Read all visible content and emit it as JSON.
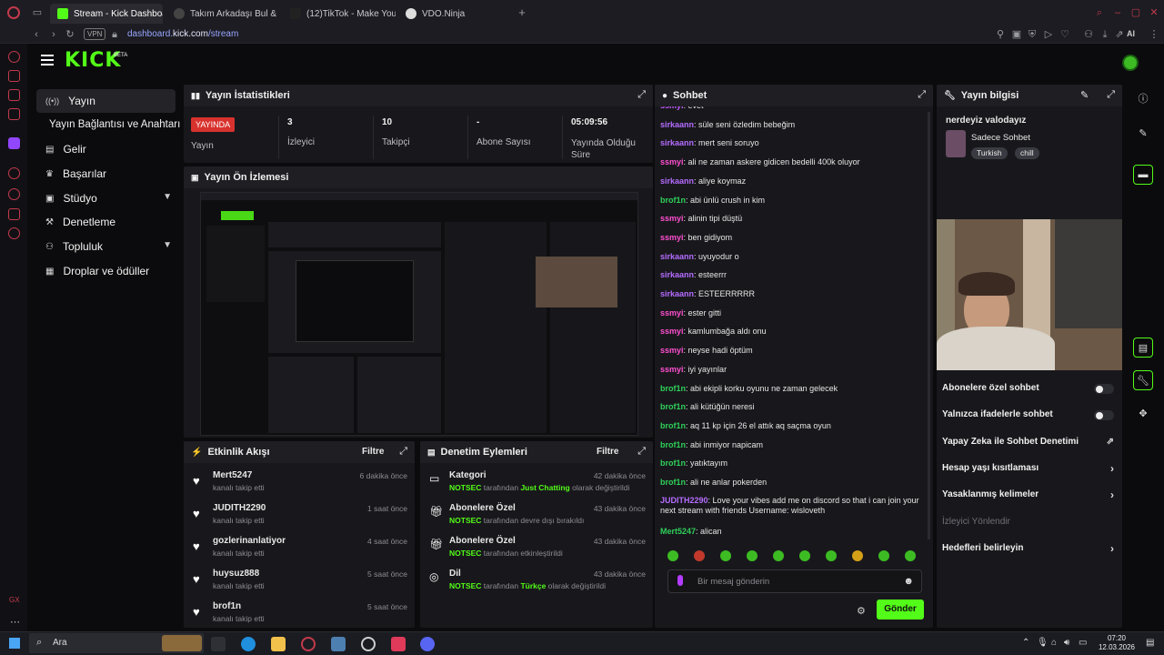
{
  "browser": {
    "tabs": [
      {
        "label": "Stream - Kick Dashboard",
        "active": true,
        "color": "#53fc18"
      },
      {
        "label": "Takım Arkadaşı Bul & Du",
        "active": false,
        "color": "#c8c8cc"
      },
      {
        "label": "(12)TikTok - Make Your D",
        "active": false,
        "color": "#c8c8cc"
      },
      {
        "label": "VDO.Ninja",
        "active": false,
        "color": "#ffffff"
      }
    ],
    "vpn": "VPN",
    "url_prefix": "dashboard.",
    "url_domain": "kick.com",
    "url_path": "/stream",
    "ai_label": "AI"
  },
  "brand": {
    "logo": "KICK",
    "badge": "BETA"
  },
  "sidebar": {
    "items": [
      {
        "label": "Yayın",
        "icon": "stream-icon"
      },
      {
        "label": "Yayın Bağlantısı ve Anahtarı",
        "icon": ""
      },
      {
        "label": "Gelir",
        "icon": "money-icon"
      },
      {
        "label": "Başarılar",
        "icon": "trophy-icon"
      },
      {
        "label": "Stüdyo",
        "icon": "studio-icon"
      },
      {
        "label": "Denetleme",
        "icon": "hammer-icon"
      },
      {
        "label": "Topluluk",
        "icon": "community-icon"
      },
      {
        "label": "Droplar ve ödüller",
        "icon": "drops-icon"
      }
    ]
  },
  "stats": {
    "title": "Yayın İstatistikleri",
    "live_badge": "YAYINDA",
    "cells": [
      {
        "value": "",
        "label": "Yayın"
      },
      {
        "value": "3",
        "label": "İzleyici"
      },
      {
        "value": "10",
        "label": "Takipçi"
      },
      {
        "value": "-",
        "label": "Abone Sayısı"
      },
      {
        "value": "05:09:56",
        "label": "Yayında Olduğu Süre"
      }
    ]
  },
  "preview": {
    "title": "Yayın Ön İzlemesi"
  },
  "activity": {
    "title": "Etkinlik Akışı",
    "filter": "Filtre",
    "items": [
      {
        "user": "Mert5247",
        "action": "kanalı takip etti",
        "time": "6 dakika önce"
      },
      {
        "user": "JUDITH2290",
        "action": "kanalı takip etti",
        "time": "1 saat önce"
      },
      {
        "user": "gozlerinanlatiyor",
        "action": "kanalı takip etti",
        "time": "4 saat önce"
      },
      {
        "user": "huysuz888",
        "action": "kanalı takip etti",
        "time": "5 saat önce"
      },
      {
        "user": "brof1n",
        "action": "kanalı takip etti",
        "time": "5 saat önce"
      }
    ]
  },
  "moderation": {
    "title": "Denetim Eylemleri",
    "filter": "Filtre",
    "items": [
      {
        "title": "Kategori",
        "actor": "NOTSEC",
        "pre": " tarafından ",
        "highlight": "Just Chatting",
        "post": " olarak değiştirildi",
        "time": "42 dakika önce",
        "icon": "category-icon"
      },
      {
        "title": "Abonelere Özel",
        "actor": "NOTSEC",
        "pre": " tarafından devre dışı bırakıldı",
        "highlight": "",
        "post": "",
        "time": "43 dakika önce",
        "icon": "gift-icon"
      },
      {
        "title": "Abonelere Özel",
        "actor": "NOTSEC",
        "pre": " tarafından etkinleştirildi",
        "highlight": "",
        "post": "",
        "time": "43 dakika önce",
        "icon": "gift-icon"
      },
      {
        "title": "Dil",
        "actor": "NOTSEC",
        "pre": " tarafından ",
        "highlight": "Türkçe",
        "post": " olarak değiştirildi",
        "time": "43 dakika önce",
        "icon": "globe-icon"
      }
    ]
  },
  "chat": {
    "title": "Sohbet",
    "messages": [
      {
        "user": "ssmyi",
        "color": "#c85cff",
        "text": "evet"
      },
      {
        "user": "sirkaann",
        "color": "#b56cff",
        "text": "süle seni özledim bebeğim"
      },
      {
        "user": "sirkaann",
        "color": "#b56cff",
        "text": "mert seni soruyo"
      },
      {
        "user": "ssmyi",
        "color": "#ff4fd1",
        "text": "ali ne zaman askere gidicen bedelli 400k oluyor"
      },
      {
        "user": "sirkaann",
        "color": "#b56cff",
        "text": "aliye koymaz"
      },
      {
        "user": "brof1n",
        "color": "#2fd05a",
        "text": "abi ünlü crush in kim"
      },
      {
        "user": "ssmyi",
        "color": "#ff4fd1",
        "text": "alinin tipi düştü"
      },
      {
        "user": "ssmyi",
        "color": "#ff4fd1",
        "text": "ben gidiyom"
      },
      {
        "user": "sirkaann",
        "color": "#b56cff",
        "text": "uyuyodur o"
      },
      {
        "user": "sirkaann",
        "color": "#b56cff",
        "text": "esteerrr"
      },
      {
        "user": "sirkaann",
        "color": "#b56cff",
        "text": "ESTEERRRRR"
      },
      {
        "user": "ssmyi",
        "color": "#ff4fd1",
        "text": "ester gitti"
      },
      {
        "user": "ssmyi",
        "color": "#ff4fd1",
        "text": "kamlumbağa aldı onu"
      },
      {
        "user": "ssmyi",
        "color": "#ff4fd1",
        "text": "neyse hadi öptüm"
      },
      {
        "user": "ssmyi",
        "color": "#ff4fd1",
        "text": "iyi yayınlar"
      },
      {
        "user": "brof1n",
        "color": "#2fd05a",
        "text": "abi ekipli korku oyunu ne zaman gelecek"
      },
      {
        "user": "brof1n",
        "color": "#2fd05a",
        "text": "ali kütüğün neresi"
      },
      {
        "user": "brof1n",
        "color": "#2fd05a",
        "text": "aq 11 kp için 26 el attık aq saçma oyun"
      },
      {
        "user": "brof1n",
        "color": "#2fd05a",
        "text": "abi inmiyor napicam"
      },
      {
        "user": "brof1n",
        "color": "#2fd05a",
        "text": "yatıktayım"
      },
      {
        "user": "brof1n",
        "color": "#2fd05a",
        "text": "ali ne anlar pokerden"
      },
      {
        "user": "JUDITH2290",
        "color": "#b56cff",
        "text": "Love your vibes add me on discord so that i can join your next stream with friends Username: wisloveth"
      },
      {
        "user": "Mert5247",
        "color": "#2fd05a",
        "text": "alican"
      }
    ],
    "placeholder": "Bir mesaj gönderin",
    "send": "Gönder"
  },
  "info": {
    "title": "Yayın bilgisi",
    "stream_title": "nerdeyiz valodayız",
    "category": "Sadece Sohbet",
    "tags": [
      "Turkish",
      "chill"
    ]
  },
  "settings": {
    "rows": [
      {
        "label": "Abonelere özel sohbet",
        "control": "toggle"
      },
      {
        "label": "Yalnızca ifadelerle sohbet",
        "control": "toggle"
      },
      {
        "label": "Yapay Zeka ile Sohbet Denetimi",
        "control": "external"
      },
      {
        "label": "Hesap yaşı kısıtlaması",
        "control": "chevron"
      },
      {
        "label": "Yasaklanmış kelimeler",
        "control": "chevron"
      },
      {
        "label": "İzleyici Yönlendir",
        "control": "none",
        "muted": true
      },
      {
        "label": "Hedefleri belirleyin",
        "control": "chevron"
      }
    ]
  },
  "taskbar": {
    "search": "Ara",
    "time": "07:20",
    "date": "12.03.2026"
  },
  "colors": {
    "accent": "#53fc18",
    "live": "#d8322e",
    "panel": "#18181c"
  }
}
